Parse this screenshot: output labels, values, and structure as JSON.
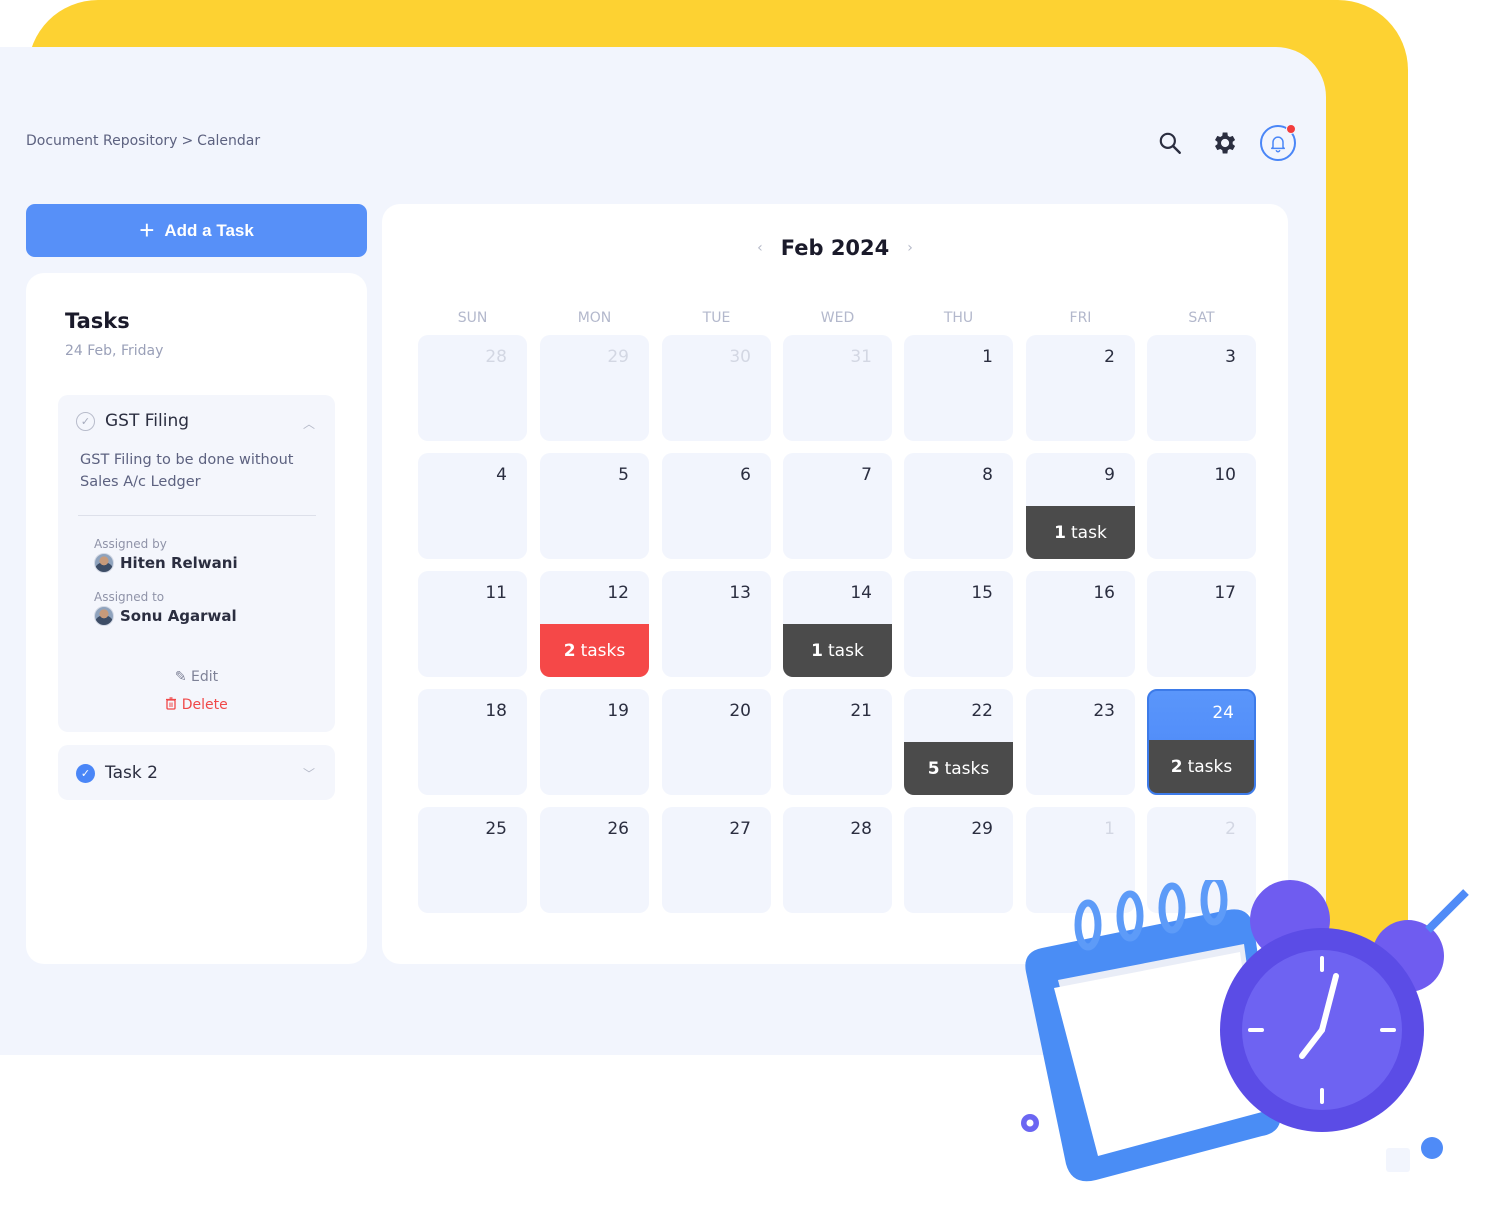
{
  "breadcrumb": {
    "parent": "Document Repository",
    "separator": ">",
    "current": "Calendar"
  },
  "header": {
    "icons": [
      "search-icon",
      "gear-icon",
      "bell-icon"
    ],
    "accent": "#4A86F7",
    "notification_color": "#F33D3D"
  },
  "add_task": {
    "label": "Add a Task",
    "icon": "plus-icon"
  },
  "tasks_panel": {
    "title": "Tasks",
    "date": "24 Feb, Friday",
    "tasks": [
      {
        "name": "GST Filing",
        "done": false,
        "expanded": true,
        "description": "GST Filing to be done without Sales A/c Ledger",
        "assigned_by_label": "Assigned by",
        "assigned_by": "Hiten Relwani",
        "assigned_to_label": "Assigned to",
        "assigned_to": "Sonu Agarwal",
        "edit_label": "Edit",
        "delete_label": "Delete"
      },
      {
        "name": "Task 2",
        "done": true,
        "expanded": false
      }
    ]
  },
  "calendar": {
    "month_label": "Feb 2024",
    "weekdays": [
      "SUN",
      "MON",
      "TUE",
      "WED",
      "THU",
      "FRI",
      "SAT"
    ],
    "task_word_singular": "task",
    "task_word_plural": "tasks",
    "weeks": [
      [
        {
          "day": "28",
          "outside": true
        },
        {
          "day": "29",
          "outside": true
        },
        {
          "day": "30",
          "outside": true
        },
        {
          "day": "31",
          "outside": true
        },
        {
          "day": "1"
        },
        {
          "day": "2"
        },
        {
          "day": "3"
        }
      ],
      [
        {
          "day": "4"
        },
        {
          "day": "5"
        },
        {
          "day": "6"
        },
        {
          "day": "7"
        },
        {
          "day": "8"
        },
        {
          "day": "9",
          "tasks": 1,
          "chip": "dark"
        },
        {
          "day": "10"
        }
      ],
      [
        {
          "day": "11"
        },
        {
          "day": "12",
          "tasks": 2,
          "chip": "red"
        },
        {
          "day": "13"
        },
        {
          "day": "14",
          "tasks": 1,
          "chip": "dark"
        },
        {
          "day": "15"
        },
        {
          "day": "16"
        },
        {
          "day": "17"
        }
      ],
      [
        {
          "day": "18"
        },
        {
          "day": "19"
        },
        {
          "day": "20"
        },
        {
          "day": "21"
        },
        {
          "day": "22",
          "tasks": 5,
          "chip": "dark"
        },
        {
          "day": "23"
        },
        {
          "day": "24",
          "tasks": 2,
          "chip": "dark",
          "selected": true
        }
      ],
      [
        {
          "day": "25"
        },
        {
          "day": "26"
        },
        {
          "day": "27"
        },
        {
          "day": "28"
        },
        {
          "day": "29"
        },
        {
          "day": "1",
          "outside": true
        },
        {
          "day": "2",
          "outside": true
        }
      ]
    ],
    "colors": {
      "selected": "#4A86F7",
      "chip_dark": "#4B4B4B",
      "chip_red": "#F54848",
      "cell_bg": "#F2F5FD"
    }
  },
  "decoration": {
    "icons": [
      "calendar-3d-icon",
      "alarm-clock-icon"
    ]
  }
}
